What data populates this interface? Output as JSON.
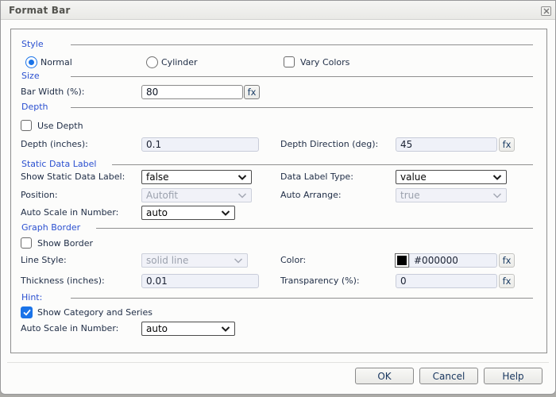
{
  "window": {
    "title": "Format Bar"
  },
  "colors": {
    "accent_blue": "#1a73e8",
    "section_title_blue": "#2b50d0",
    "label_text": "#1e2c45",
    "disabled_field_bg": "#eff1f8",
    "border_color_swatch": "#000000"
  },
  "sections": {
    "style": {
      "title": "Style",
      "normal_radio": {
        "label": "Normal",
        "selected": true
      },
      "cylinder_radio": {
        "label": "Cylinder",
        "selected": false
      },
      "vary_colors_checkbox": {
        "label": "Vary Colors",
        "checked": false
      }
    },
    "size": {
      "title": "Size",
      "bar_width": {
        "label": "Bar Width (%):",
        "value": "80",
        "fx": "fx"
      }
    },
    "depth": {
      "title": "Depth",
      "use_depth_checkbox": {
        "label": "Use Depth",
        "checked": false
      },
      "depth_inches": {
        "label": "Depth (inches):",
        "value": "0.1",
        "enabled": false
      },
      "depth_direction": {
        "label": "Depth Direction (deg):",
        "value": "45",
        "enabled": false,
        "fx": "fx"
      }
    },
    "static_data_label": {
      "title": "Static Data Label",
      "show_static_data_label": {
        "label": "Show Static Data Label:",
        "value": "false",
        "enabled": true
      },
      "data_label_type": {
        "label": "Data Label Type:",
        "value": "value",
        "enabled": true
      },
      "position": {
        "label": "Position:",
        "value": "Autofit",
        "enabled": false
      },
      "auto_arrange": {
        "label": "Auto Arrange:",
        "value": "true",
        "enabled": false
      },
      "auto_scale_in_number": {
        "label": "Auto Scale in Number:",
        "value": "auto",
        "enabled": true
      }
    },
    "graph_border": {
      "title": "Graph Border",
      "show_border_checkbox": {
        "label": "Show Border",
        "checked": false
      },
      "line_style": {
        "label": "Line Style:",
        "value": "solid line",
        "enabled": false
      },
      "border_color": {
        "label": "Color:",
        "value": "#000000",
        "swatch": "#000000",
        "fx": "fx"
      },
      "thickness": {
        "label": "Thickness (inches):",
        "value": "0.01",
        "enabled": false
      },
      "transparency": {
        "label": "Transparency (%):",
        "value": "0",
        "enabled": false,
        "fx": "fx"
      }
    },
    "hint": {
      "title": "Hint:",
      "show_category_series_checkbox": {
        "label": "Show Category and Series",
        "checked": true
      },
      "auto_scale_in_number": {
        "label": "Auto Scale in Number:",
        "value": "auto",
        "enabled": true
      }
    }
  },
  "footer": {
    "ok": "OK",
    "cancel": "Cancel",
    "help": "Help"
  }
}
